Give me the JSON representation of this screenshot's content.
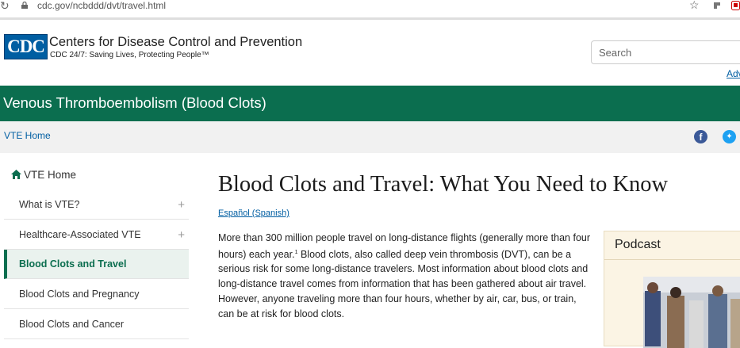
{
  "browser": {
    "url": "cdc.gov/ncbddd/dvt/travel.html"
  },
  "header": {
    "logo_text": "CDC",
    "org_name": "Centers for Disease Control and Prevention",
    "tagline": "CDC 24/7: Saving Lives, Protecting People™",
    "search_placeholder": "Search",
    "advanced_link": "Adv"
  },
  "banner": {
    "title": "Venous Thromboembolism (Blood Clots)"
  },
  "subnav": {
    "home_link": "VTE Home",
    "social": [
      "facebook-icon",
      "twitter-icon"
    ]
  },
  "sidebar": {
    "home_label": "VTE Home",
    "items": [
      {
        "label": "What is VTE?",
        "expandable": true,
        "active": false
      },
      {
        "label": "Healthcare-Associated VTE",
        "expandable": true,
        "active": false
      },
      {
        "label": "Blood Clots and Travel",
        "expandable": false,
        "active": true
      },
      {
        "label": "Blood Clots and Pregnancy",
        "expandable": false,
        "active": false
      },
      {
        "label": "Blood Clots and Cancer",
        "expandable": false,
        "active": false
      }
    ]
  },
  "main": {
    "title": "Blood Clots and Travel: What You Need to Know",
    "language_link": "Español (Spanish)",
    "paragraph_part1": "More than 300 million people travel on long-distance flights (generally more than four hours) each year.",
    "footnote": "1",
    "paragraph_part2": " Blood clots, also called deep vein thrombosis (DVT), can be a serious risk for some long-distance travelers. Most information about blood clots and long-distance travel comes from information that has been gathered about air travel. However, anyone traveling more than four hours, whether by air, car, bus, or train, can be at risk for blood clots."
  },
  "podcast": {
    "title": "Podcast"
  },
  "colors": {
    "brand_green": "#0b6e4f",
    "link_blue": "#005ea2",
    "podcast_bg": "#fbf4e4"
  }
}
